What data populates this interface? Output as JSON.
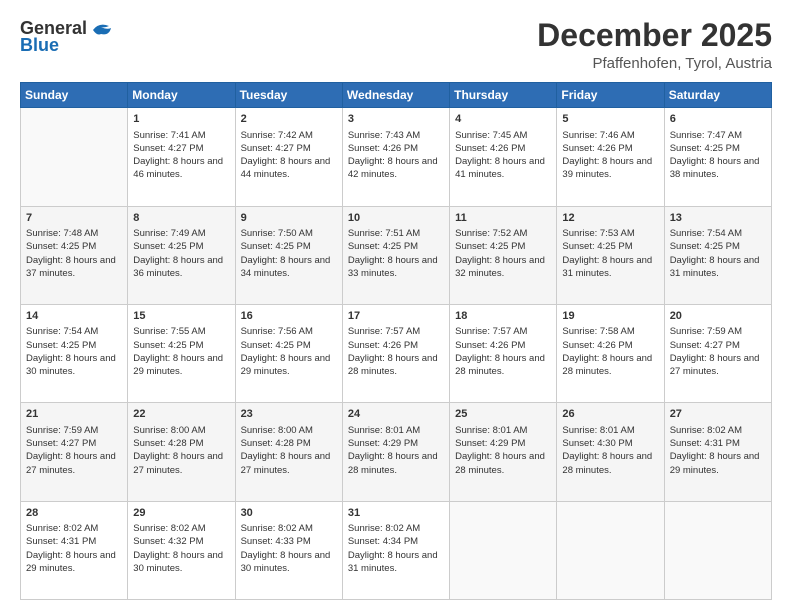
{
  "header": {
    "logo_general": "General",
    "logo_blue": "Blue",
    "month_title": "December 2025",
    "location": "Pfaffenhofen, Tyrol, Austria"
  },
  "weekdays": [
    "Sunday",
    "Monday",
    "Tuesday",
    "Wednesday",
    "Thursday",
    "Friday",
    "Saturday"
  ],
  "weeks": [
    [
      {
        "day": "",
        "sunrise": "",
        "sunset": "",
        "daylight": ""
      },
      {
        "day": "1",
        "sunrise": "Sunrise: 7:41 AM",
        "sunset": "Sunset: 4:27 PM",
        "daylight": "Daylight: 8 hours and 46 minutes."
      },
      {
        "day": "2",
        "sunrise": "Sunrise: 7:42 AM",
        "sunset": "Sunset: 4:27 PM",
        "daylight": "Daylight: 8 hours and 44 minutes."
      },
      {
        "day": "3",
        "sunrise": "Sunrise: 7:43 AM",
        "sunset": "Sunset: 4:26 PM",
        "daylight": "Daylight: 8 hours and 42 minutes."
      },
      {
        "day": "4",
        "sunrise": "Sunrise: 7:45 AM",
        "sunset": "Sunset: 4:26 PM",
        "daylight": "Daylight: 8 hours and 41 minutes."
      },
      {
        "day": "5",
        "sunrise": "Sunrise: 7:46 AM",
        "sunset": "Sunset: 4:26 PM",
        "daylight": "Daylight: 8 hours and 39 minutes."
      },
      {
        "day": "6",
        "sunrise": "Sunrise: 7:47 AM",
        "sunset": "Sunset: 4:25 PM",
        "daylight": "Daylight: 8 hours and 38 minutes."
      }
    ],
    [
      {
        "day": "7",
        "sunrise": "Sunrise: 7:48 AM",
        "sunset": "Sunset: 4:25 PM",
        "daylight": "Daylight: 8 hours and 37 minutes."
      },
      {
        "day": "8",
        "sunrise": "Sunrise: 7:49 AM",
        "sunset": "Sunset: 4:25 PM",
        "daylight": "Daylight: 8 hours and 36 minutes."
      },
      {
        "day": "9",
        "sunrise": "Sunrise: 7:50 AM",
        "sunset": "Sunset: 4:25 PM",
        "daylight": "Daylight: 8 hours and 34 minutes."
      },
      {
        "day": "10",
        "sunrise": "Sunrise: 7:51 AM",
        "sunset": "Sunset: 4:25 PM",
        "daylight": "Daylight: 8 hours and 33 minutes."
      },
      {
        "day": "11",
        "sunrise": "Sunrise: 7:52 AM",
        "sunset": "Sunset: 4:25 PM",
        "daylight": "Daylight: 8 hours and 32 minutes."
      },
      {
        "day": "12",
        "sunrise": "Sunrise: 7:53 AM",
        "sunset": "Sunset: 4:25 PM",
        "daylight": "Daylight: 8 hours and 31 minutes."
      },
      {
        "day": "13",
        "sunrise": "Sunrise: 7:54 AM",
        "sunset": "Sunset: 4:25 PM",
        "daylight": "Daylight: 8 hours and 31 minutes."
      }
    ],
    [
      {
        "day": "14",
        "sunrise": "Sunrise: 7:54 AM",
        "sunset": "Sunset: 4:25 PM",
        "daylight": "Daylight: 8 hours and 30 minutes."
      },
      {
        "day": "15",
        "sunrise": "Sunrise: 7:55 AM",
        "sunset": "Sunset: 4:25 PM",
        "daylight": "Daylight: 8 hours and 29 minutes."
      },
      {
        "day": "16",
        "sunrise": "Sunrise: 7:56 AM",
        "sunset": "Sunset: 4:25 PM",
        "daylight": "Daylight: 8 hours and 29 minutes."
      },
      {
        "day": "17",
        "sunrise": "Sunrise: 7:57 AM",
        "sunset": "Sunset: 4:26 PM",
        "daylight": "Daylight: 8 hours and 28 minutes."
      },
      {
        "day": "18",
        "sunrise": "Sunrise: 7:57 AM",
        "sunset": "Sunset: 4:26 PM",
        "daylight": "Daylight: 8 hours and 28 minutes."
      },
      {
        "day": "19",
        "sunrise": "Sunrise: 7:58 AM",
        "sunset": "Sunset: 4:26 PM",
        "daylight": "Daylight: 8 hours and 28 minutes."
      },
      {
        "day": "20",
        "sunrise": "Sunrise: 7:59 AM",
        "sunset": "Sunset: 4:27 PM",
        "daylight": "Daylight: 8 hours and 27 minutes."
      }
    ],
    [
      {
        "day": "21",
        "sunrise": "Sunrise: 7:59 AM",
        "sunset": "Sunset: 4:27 PM",
        "daylight": "Daylight: 8 hours and 27 minutes."
      },
      {
        "day": "22",
        "sunrise": "Sunrise: 8:00 AM",
        "sunset": "Sunset: 4:28 PM",
        "daylight": "Daylight: 8 hours and 27 minutes."
      },
      {
        "day": "23",
        "sunrise": "Sunrise: 8:00 AM",
        "sunset": "Sunset: 4:28 PM",
        "daylight": "Daylight: 8 hours and 27 minutes."
      },
      {
        "day": "24",
        "sunrise": "Sunrise: 8:01 AM",
        "sunset": "Sunset: 4:29 PM",
        "daylight": "Daylight: 8 hours and 28 minutes."
      },
      {
        "day": "25",
        "sunrise": "Sunrise: 8:01 AM",
        "sunset": "Sunset: 4:29 PM",
        "daylight": "Daylight: 8 hours and 28 minutes."
      },
      {
        "day": "26",
        "sunrise": "Sunrise: 8:01 AM",
        "sunset": "Sunset: 4:30 PM",
        "daylight": "Daylight: 8 hours and 28 minutes."
      },
      {
        "day": "27",
        "sunrise": "Sunrise: 8:02 AM",
        "sunset": "Sunset: 4:31 PM",
        "daylight": "Daylight: 8 hours and 29 minutes."
      }
    ],
    [
      {
        "day": "28",
        "sunrise": "Sunrise: 8:02 AM",
        "sunset": "Sunset: 4:31 PM",
        "daylight": "Daylight: 8 hours and 29 minutes."
      },
      {
        "day": "29",
        "sunrise": "Sunrise: 8:02 AM",
        "sunset": "Sunset: 4:32 PM",
        "daylight": "Daylight: 8 hours and 30 minutes."
      },
      {
        "day": "30",
        "sunrise": "Sunrise: 8:02 AM",
        "sunset": "Sunset: 4:33 PM",
        "daylight": "Daylight: 8 hours and 30 minutes."
      },
      {
        "day": "31",
        "sunrise": "Sunrise: 8:02 AM",
        "sunset": "Sunset: 4:34 PM",
        "daylight": "Daylight: 8 hours and 31 minutes."
      },
      {
        "day": "",
        "sunrise": "",
        "sunset": "",
        "daylight": ""
      },
      {
        "day": "",
        "sunrise": "",
        "sunset": "",
        "daylight": ""
      },
      {
        "day": "",
        "sunrise": "",
        "sunset": "",
        "daylight": ""
      }
    ]
  ]
}
